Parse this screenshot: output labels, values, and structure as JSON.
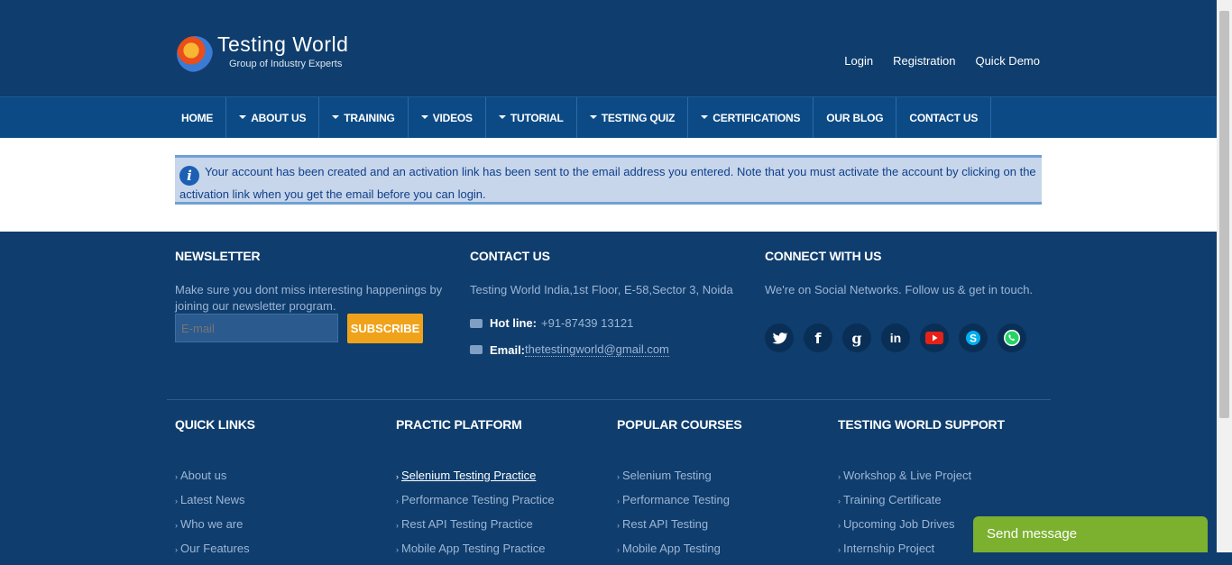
{
  "header": {
    "logo_title": "Testing World",
    "logo_subtitle": "Group of Industry Experts",
    "links": [
      "Login",
      "Registration",
      "Quick Demo"
    ]
  },
  "nav": {
    "items": [
      {
        "label": "HOME",
        "dropdown": false
      },
      {
        "label": "ABOUT US",
        "dropdown": true
      },
      {
        "label": "TRAINING",
        "dropdown": true
      },
      {
        "label": "VIDEOS",
        "dropdown": true
      },
      {
        "label": "TUTORIAL",
        "dropdown": true
      },
      {
        "label": "TESTING QUIZ",
        "dropdown": true
      },
      {
        "label": "CERTIFICATIONS",
        "dropdown": true
      },
      {
        "label": "OUR BLOG",
        "dropdown": false
      },
      {
        "label": "CONTACT US",
        "dropdown": false
      }
    ]
  },
  "alert": {
    "icon": "info-icon",
    "text": "Your account has been created and an activation link has been sent to the email address you entered. Note that you must activate the account by clicking on the activation link when you get the email before you can login."
  },
  "newsletter": {
    "heading": "NEWSLETTER",
    "text": "Make sure you dont miss interesting happenings by joining our newsletter program.",
    "placeholder": "E-mail",
    "button": "SUBSCRIBE"
  },
  "contact": {
    "heading": "CONTACT US",
    "address": "Testing World India,1st Floor, E-58,Sector 3, Noida",
    "hotline_label": "Hot line:",
    "hotline_value": "+91-87439 13121",
    "email_label": "Email:",
    "email_value": "thetestingworld@gmail.com"
  },
  "connect": {
    "heading": "CONNECT WITH US",
    "text": "We're on Social Networks. Follow us & get in touch.",
    "icons": [
      "twitter-icon",
      "facebook-icon",
      "google-plus-icon",
      "linkedin-icon",
      "youtube-icon",
      "skype-icon",
      "whatsapp-icon"
    ]
  },
  "quick_links": {
    "heading": "QUICK LINKS",
    "items": [
      "About us",
      "Latest News",
      "Who we are",
      "Our Features"
    ]
  },
  "practic_platform": {
    "heading": "PRACTIC PLATFORM",
    "items": [
      "Selenium Testing Practice",
      "Performance Testing Practice",
      "Rest API Testing Practice",
      "Mobile App Testing Practice"
    ]
  },
  "popular_courses": {
    "heading": "POPULAR COURSES",
    "items": [
      "Selenium Testing",
      "Performance Testing",
      "Rest API Testing",
      "Mobile App Testing"
    ]
  },
  "support": {
    "heading": "TESTING WORLD SUPPORT",
    "items": [
      "Workshop & Live Project",
      "Training Certificate",
      "Upcoming Job Drives",
      "Internship Project"
    ]
  },
  "chat": {
    "label": "Send message"
  },
  "colors": {
    "primary": "#0f3d6d",
    "nav": "#0b4a85",
    "accent": "#f0a31a",
    "chat": "#7bb12e"
  }
}
